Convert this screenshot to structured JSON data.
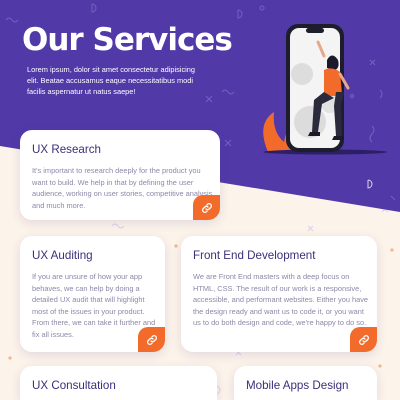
{
  "hero": {
    "title": "Our Services",
    "description": "Lorem ipsum, dolor sit amet consectetur adipisicing elit. Beatae accusamus eaque necessitatibus modi facilis aspernatur ut natus saepe!"
  },
  "cards": [
    {
      "title": "UX Research",
      "body": "It's important to research deeply for the product you want to build. We help in that by defining the user audience, working on user stories, competitive analysis and much more.",
      "icon": "link-icon"
    },
    {
      "title": "UX Auditing",
      "body": "If you are unsure of how your app behaves, we can help by doing a detailed UX audit that will highlight most of the issues in your product. From there, we can take it further and fix all issues.",
      "icon": "link-icon"
    },
    {
      "title": "Front End Development",
      "body": "We are Front End masters with a deep focus on HTML, CSS. The result of our work is a responsive, accessible, and performant websites. Either you have the design ready and want us to code it, or you want us to do both design and code, we're happy to do so.",
      "icon": "link-icon"
    },
    {
      "title": "UX Consultation",
      "body": ""
    },
    {
      "title": "Mobile Apps Design",
      "body": ""
    }
  ],
  "colors": {
    "hero_purple": "#5139a8",
    "page_cream": "#fcf3ea",
    "accent_orange": "#f26b2a",
    "heading_navy": "#3b2f7a"
  }
}
